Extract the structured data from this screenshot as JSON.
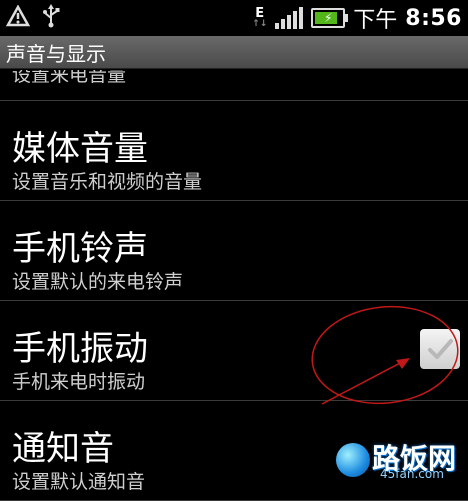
{
  "status_bar": {
    "network_label": "E",
    "ampm": "下午",
    "time": "8:56",
    "icons": [
      "alert-icon",
      "usb-icon",
      "edge-network-icon",
      "signal-icon",
      "battery-charging-icon"
    ],
    "battery_color": "#53b61a"
  },
  "titlebar": {
    "title": "声音与显示"
  },
  "list": {
    "partial_item": {
      "subtitle": "设置来电音量"
    },
    "items": [
      {
        "title": "媒体音量",
        "subtitle": "设置音乐和视频的音量"
      },
      {
        "title": "手机铃声",
        "subtitle": "设置默认的来电铃声"
      },
      {
        "title": "手机振动",
        "subtitle": "手机来电时振动",
        "checked": true
      },
      {
        "title": "通知音",
        "subtitle": "设置默认通知音"
      }
    ]
  },
  "watermark": {
    "text": "路饭网",
    "site": "45fan.com"
  }
}
